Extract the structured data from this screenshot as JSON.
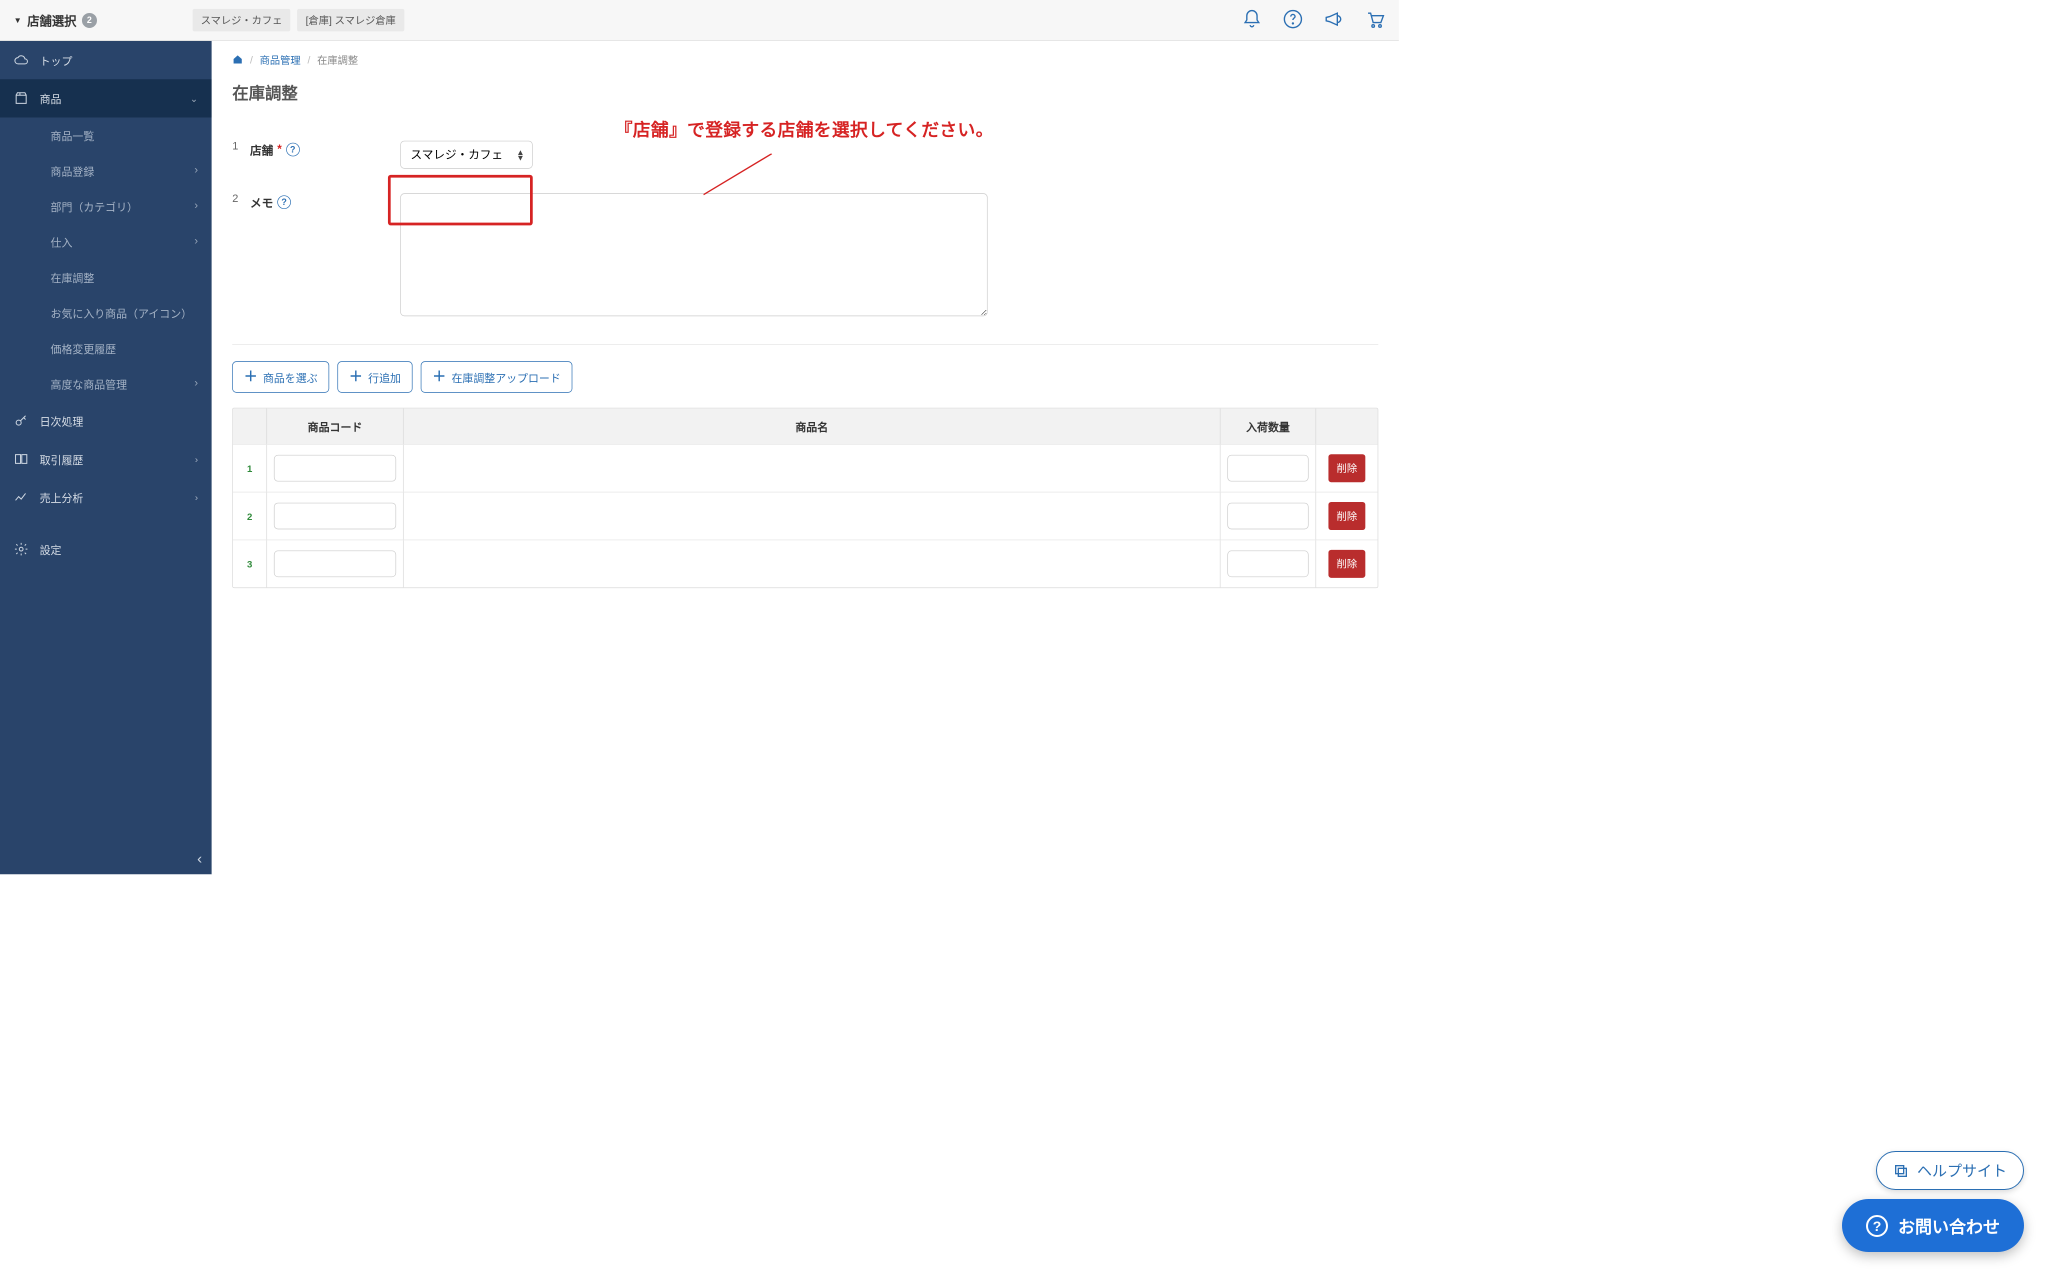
{
  "topbar": {
    "store_selector_label": "店舗選択",
    "store_badge": "2",
    "tags": [
      "スマレジ・カフェ",
      "[倉庫] スマレジ倉庫"
    ]
  },
  "sidebar": {
    "top": "トップ",
    "products": "商品",
    "sub": {
      "list": "商品一覧",
      "register": "商品登録",
      "category": "部門（カテゴリ）",
      "supply": "仕入",
      "stock_adj": "在庫調整",
      "favorite": "お気に入り商品（アイコン）",
      "price_history": "価格変更履歴",
      "advanced": "高度な商品管理"
    },
    "daily": "日次処理",
    "transactions": "取引履歴",
    "sales": "売上分析",
    "settings": "設定"
  },
  "breadcrumb": {
    "product_mgmt": "商品管理",
    "current": "在庫調整"
  },
  "annotation": "『店舗』で登録する店舗を選択してください。",
  "page_title": "在庫調整",
  "form": {
    "row1_num": "1",
    "store_label": "店舗",
    "store_value": "スマレジ・カフェ",
    "row2_num": "2",
    "memo_label": "メモ"
  },
  "buttons": {
    "choose_product": "商品を選ぶ",
    "add_row": "行追加",
    "upload": "在庫調整アップロード"
  },
  "table": {
    "col_code": "商品コード",
    "col_name": "商品名",
    "col_qty": "入荷数量",
    "delete": "削除",
    "rows": [
      "1",
      "2",
      "3"
    ]
  },
  "float": {
    "help_site": "ヘルプサイト",
    "contact": "お問い合わせ"
  }
}
